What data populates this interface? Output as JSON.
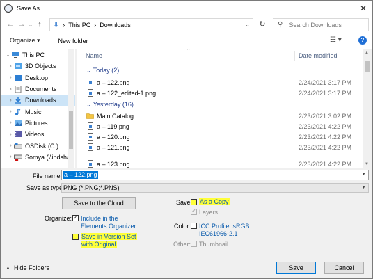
{
  "window": {
    "title": "Save As",
    "close_glyph": "✕"
  },
  "nav": {
    "back_icon": "←",
    "forward_icon": "→",
    "recent_icon": "⌄",
    "up_icon": "↑",
    "breadcrumb": [
      "This PC",
      "Downloads"
    ],
    "breadcrumb_sep": "›",
    "refresh_icon": "↻",
    "search_placeholder": "Search Downloads"
  },
  "toolbar": {
    "organize": "Organize ▾",
    "new_folder": "New folder",
    "view_icon": "☷ ▾",
    "help": "?"
  },
  "tree": [
    {
      "label": "This PC",
      "expanded": true,
      "icon": "pc-icon",
      "indent": 0
    },
    {
      "label": "3D Objects",
      "icon": "3d-objects-icon",
      "indent": 1
    },
    {
      "label": "Desktop",
      "icon": "desktop-icon",
      "indent": 1
    },
    {
      "label": "Documents",
      "icon": "documents-icon",
      "indent": 1
    },
    {
      "label": "Downloads",
      "icon": "downloads-icon",
      "indent": 1,
      "selected": true
    },
    {
      "label": "Music",
      "icon": "music-icon",
      "indent": 1
    },
    {
      "label": "Pictures",
      "icon": "pictures-icon",
      "indent": 1
    },
    {
      "label": "Videos",
      "icon": "videos-icon",
      "indent": 1
    },
    {
      "label": "OSDisk (C:)",
      "icon": "drive-icon",
      "indent": 1
    },
    {
      "label": "Somya (\\\\indsha",
      "icon": "network-drive-icon",
      "indent": 1
    }
  ],
  "files": {
    "columns": {
      "name": "Name",
      "date": "Date modified"
    },
    "groups": [
      {
        "label": "Today (2)",
        "rows": [
          {
            "name": "a – 122.png",
            "date": "2/24/2021 3:17 PM",
            "type": "image"
          },
          {
            "name": "a – 122_edited-1.png",
            "date": "2/24/2021 3:17 PM",
            "type": "image"
          }
        ]
      },
      {
        "label": "Yesterday (16)",
        "rows": [
          {
            "name": "Main Catalog",
            "date": "2/23/2021 3:02 PM",
            "type": "folder"
          },
          {
            "name": "a – 119.png",
            "date": "2/23/2021 4:22 PM",
            "type": "image"
          },
          {
            "name": "a – 120.png",
            "date": "2/23/2021 4:22 PM",
            "type": "image"
          },
          {
            "name": "a – 121.png",
            "date": "2/23/2021 4:22 PM",
            "type": "image"
          },
          {
            "name": "a – 123.png",
            "date": "2/23/2021 4:22 PM",
            "type": "image"
          }
        ]
      }
    ]
  },
  "form": {
    "file_name_label": "File name:",
    "file_name_value": "a – 122.png",
    "save_type_label": "Save as type:",
    "save_type_value": "PNG (*.PNG;*.PNS)",
    "cloud_button": "Save to the Cloud",
    "organize_label": "Organize:",
    "include_elements": "Include in the",
    "include_elements_2": "Elements Organizer",
    "version_set": "Save in Version Set",
    "version_set_2": "with Original",
    "save_label": "Save:",
    "as_copy": "As a Copy",
    "layers": "Layers",
    "color_label": "Color:",
    "icc_profile": "ICC Profile:  sRGB",
    "icc_profile_2": "IEC61966-2.1",
    "other_label": "Other:",
    "thumbnail": "Thumbnail"
  },
  "footer": {
    "hide_folders": "Hide Folders",
    "save": "Save",
    "cancel": "Cancel"
  },
  "colors": {
    "accent": "#0078d7",
    "highlight": "#ffff3a",
    "selection": "#cce4f7"
  }
}
